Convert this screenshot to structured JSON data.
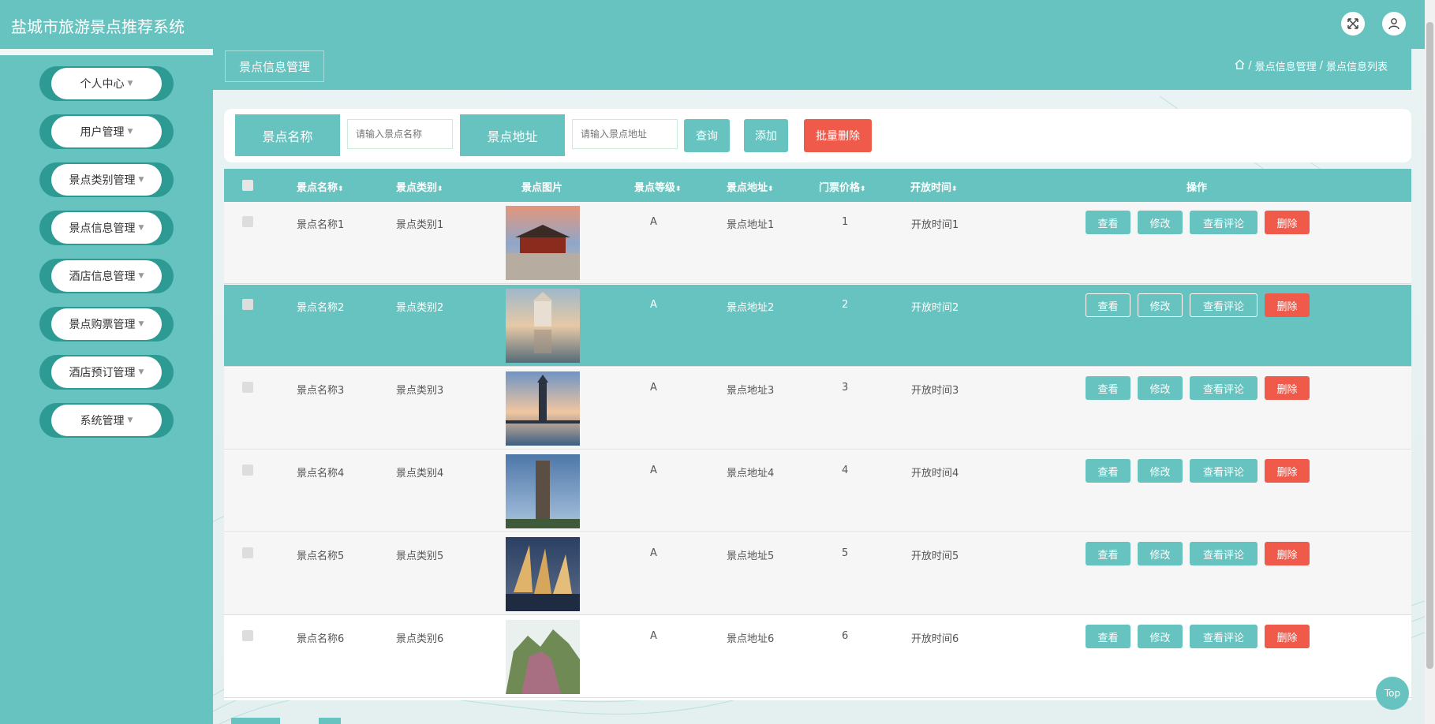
{
  "app": {
    "title": "盐城市旅游景点推荐系统"
  },
  "topbar": {
    "fullscreen_icon": "fullscreen-icon",
    "user_icon": "user-icon"
  },
  "sidebar": {
    "items": [
      {
        "label": "个人中心"
      },
      {
        "label": "用户管理"
      },
      {
        "label": "景点类别管理"
      },
      {
        "label": "景点信息管理"
      },
      {
        "label": "酒店信息管理"
      },
      {
        "label": "景点购票管理"
      },
      {
        "label": "酒店预订管理"
      },
      {
        "label": "系统管理"
      }
    ]
  },
  "page": {
    "title": "景点信息管理",
    "breadcrumb": [
      "景点信息管理",
      "景点信息列表"
    ],
    "breadcrumb_sep": "/"
  },
  "search": {
    "name_label": "景点名称",
    "name_placeholder": "请输入景点名称",
    "address_label": "景点地址",
    "address_placeholder": "请输入景点地址",
    "query_button": "查询",
    "add_button": "添加",
    "batch_delete_button": "批量删除"
  },
  "table": {
    "columns": [
      "景点名称",
      "景点类别",
      "景点图片",
      "景点等级",
      "景点地址",
      "门票价格",
      "开放时间",
      "操作"
    ],
    "actions": {
      "view": "查看",
      "edit": "修改",
      "view_comments": "查看评论",
      "delete": "删除"
    },
    "rows": [
      {
        "name": "景点名称1",
        "category": "景点类别1",
        "grade": "A",
        "address": "景点地址1",
        "price": "1",
        "hours": "开放时间1"
      },
      {
        "name": "景点名称2",
        "category": "景点类别2",
        "grade": "A",
        "address": "景点地址2",
        "price": "2",
        "hours": "开放时间2"
      },
      {
        "name": "景点名称3",
        "category": "景点类别3",
        "grade": "A",
        "address": "景点地址3",
        "price": "3",
        "hours": "开放时间3"
      },
      {
        "name": "景点名称4",
        "category": "景点类别4",
        "grade": "A",
        "address": "景点地址4",
        "price": "4",
        "hours": "开放时间4"
      },
      {
        "name": "景点名称5",
        "category": "景点类别5",
        "grade": "A",
        "address": "景点地址5",
        "price": "5",
        "hours": "开放时间5"
      },
      {
        "name": "景点名称6",
        "category": "景点类别6",
        "grade": "A",
        "address": "景点地址6",
        "price": "6",
        "hours": "开放时间6"
      }
    ]
  },
  "back_to_top": "Top",
  "colors": {
    "accent": "#67c3bf",
    "danger": "#f05a4b"
  }
}
